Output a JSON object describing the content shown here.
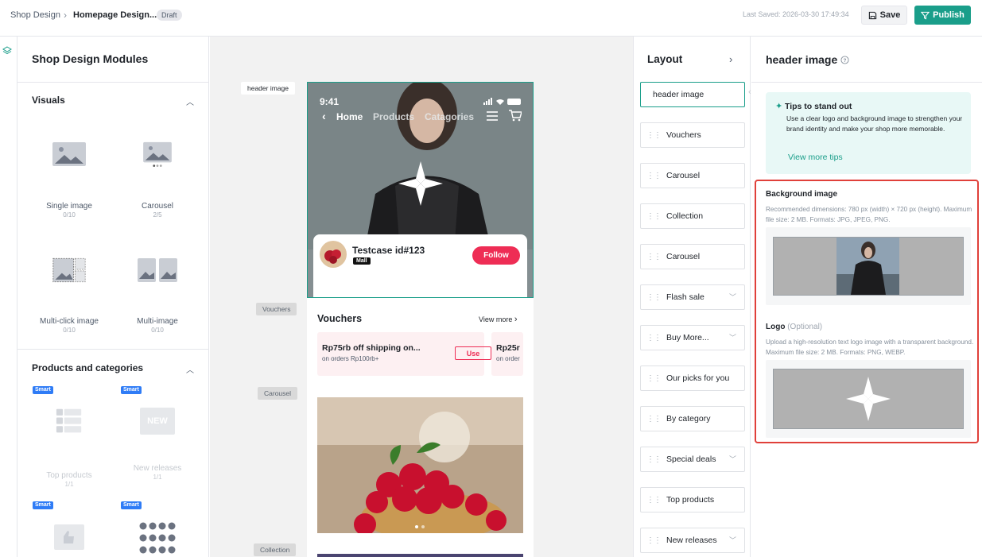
{
  "topbar": {
    "crumb_root": "Shop Design",
    "crumb_current": "Homepage Design...",
    "draft_badge": "Draft",
    "last_saved": "Last Saved: 2026-03-30 17:49:34",
    "save_label": "Save",
    "publish_label": "Publish",
    "accent": "#1a9e8a"
  },
  "modules": {
    "title": "Shop Design Modules",
    "visuals": {
      "title": "Visuals",
      "items": [
        {
          "name": "Single image",
          "count": "0/10",
          "icon": "single-image-icon"
        },
        {
          "name": "Carousel",
          "count": "2/5",
          "icon": "carousel-icon"
        },
        {
          "name": "Multi-click image",
          "count": "0/10",
          "icon": "multi-click-image-icon"
        },
        {
          "name": "Multi-image",
          "count": "0/10",
          "icon": "multi-image-icon"
        }
      ]
    },
    "products": {
      "title": "Products and categories",
      "smart_badge": "Smart",
      "items": [
        {
          "name": "Top products",
          "count": "1/1",
          "icon": "top-products-icon"
        },
        {
          "name": "New releases",
          "count": "1/1",
          "icon": "new-releases-icon",
          "icon_text": "NEW"
        }
      ]
    }
  },
  "canvas": {
    "tags": [
      "header image",
      "Vouchers",
      "Carousel",
      "Collection"
    ],
    "phone": {
      "time": "9:41",
      "nav": [
        "Home",
        "Products",
        "Catagories"
      ],
      "shop_name": "Testcase id#123",
      "mall_badge": "Mall",
      "follow_label": "Follow",
      "vouchers_title": "Vouchers",
      "view_more": "View more",
      "voucher1_title": "Rp75rb off shipping on...",
      "voucher1_sub": "on orders Rp100rb+",
      "voucher_use": "Use",
      "voucher2_title": "Rp25r",
      "voucher2_sub": "on order"
    }
  },
  "layout": {
    "title": "Layout",
    "items": [
      {
        "label": "header image"
      },
      {
        "label": "Vouchers"
      },
      {
        "label": "Carousel"
      },
      {
        "label": "Collection"
      },
      {
        "label": "Carousel"
      },
      {
        "label": "Flash sale"
      },
      {
        "label": "Buy More..."
      },
      {
        "label": "Our picks for you"
      },
      {
        "label": "By category"
      },
      {
        "label": "Special deals"
      },
      {
        "label": "Top products"
      },
      {
        "label": "New releases"
      }
    ]
  },
  "props": {
    "title": "header image",
    "tips_title": "Tips to stand out",
    "tips_body": "Use a clear logo and background image to strengthen your brand identity and make your shop more memorable.",
    "tips_link": "View more tips",
    "bg_label": "Background image",
    "bg_desc": "Recommended dimensions: 780 px (width) × 720 px (height). Maximum file size: 2 MB. Formats: JPG, JPEG, PNG.",
    "logo_label": "Logo",
    "logo_optional": "(Optional)",
    "logo_desc": "Upload a high-resolution text logo image with a transparent background. Maximum file size: 2 MB. Formats: PNG, WEBP."
  }
}
